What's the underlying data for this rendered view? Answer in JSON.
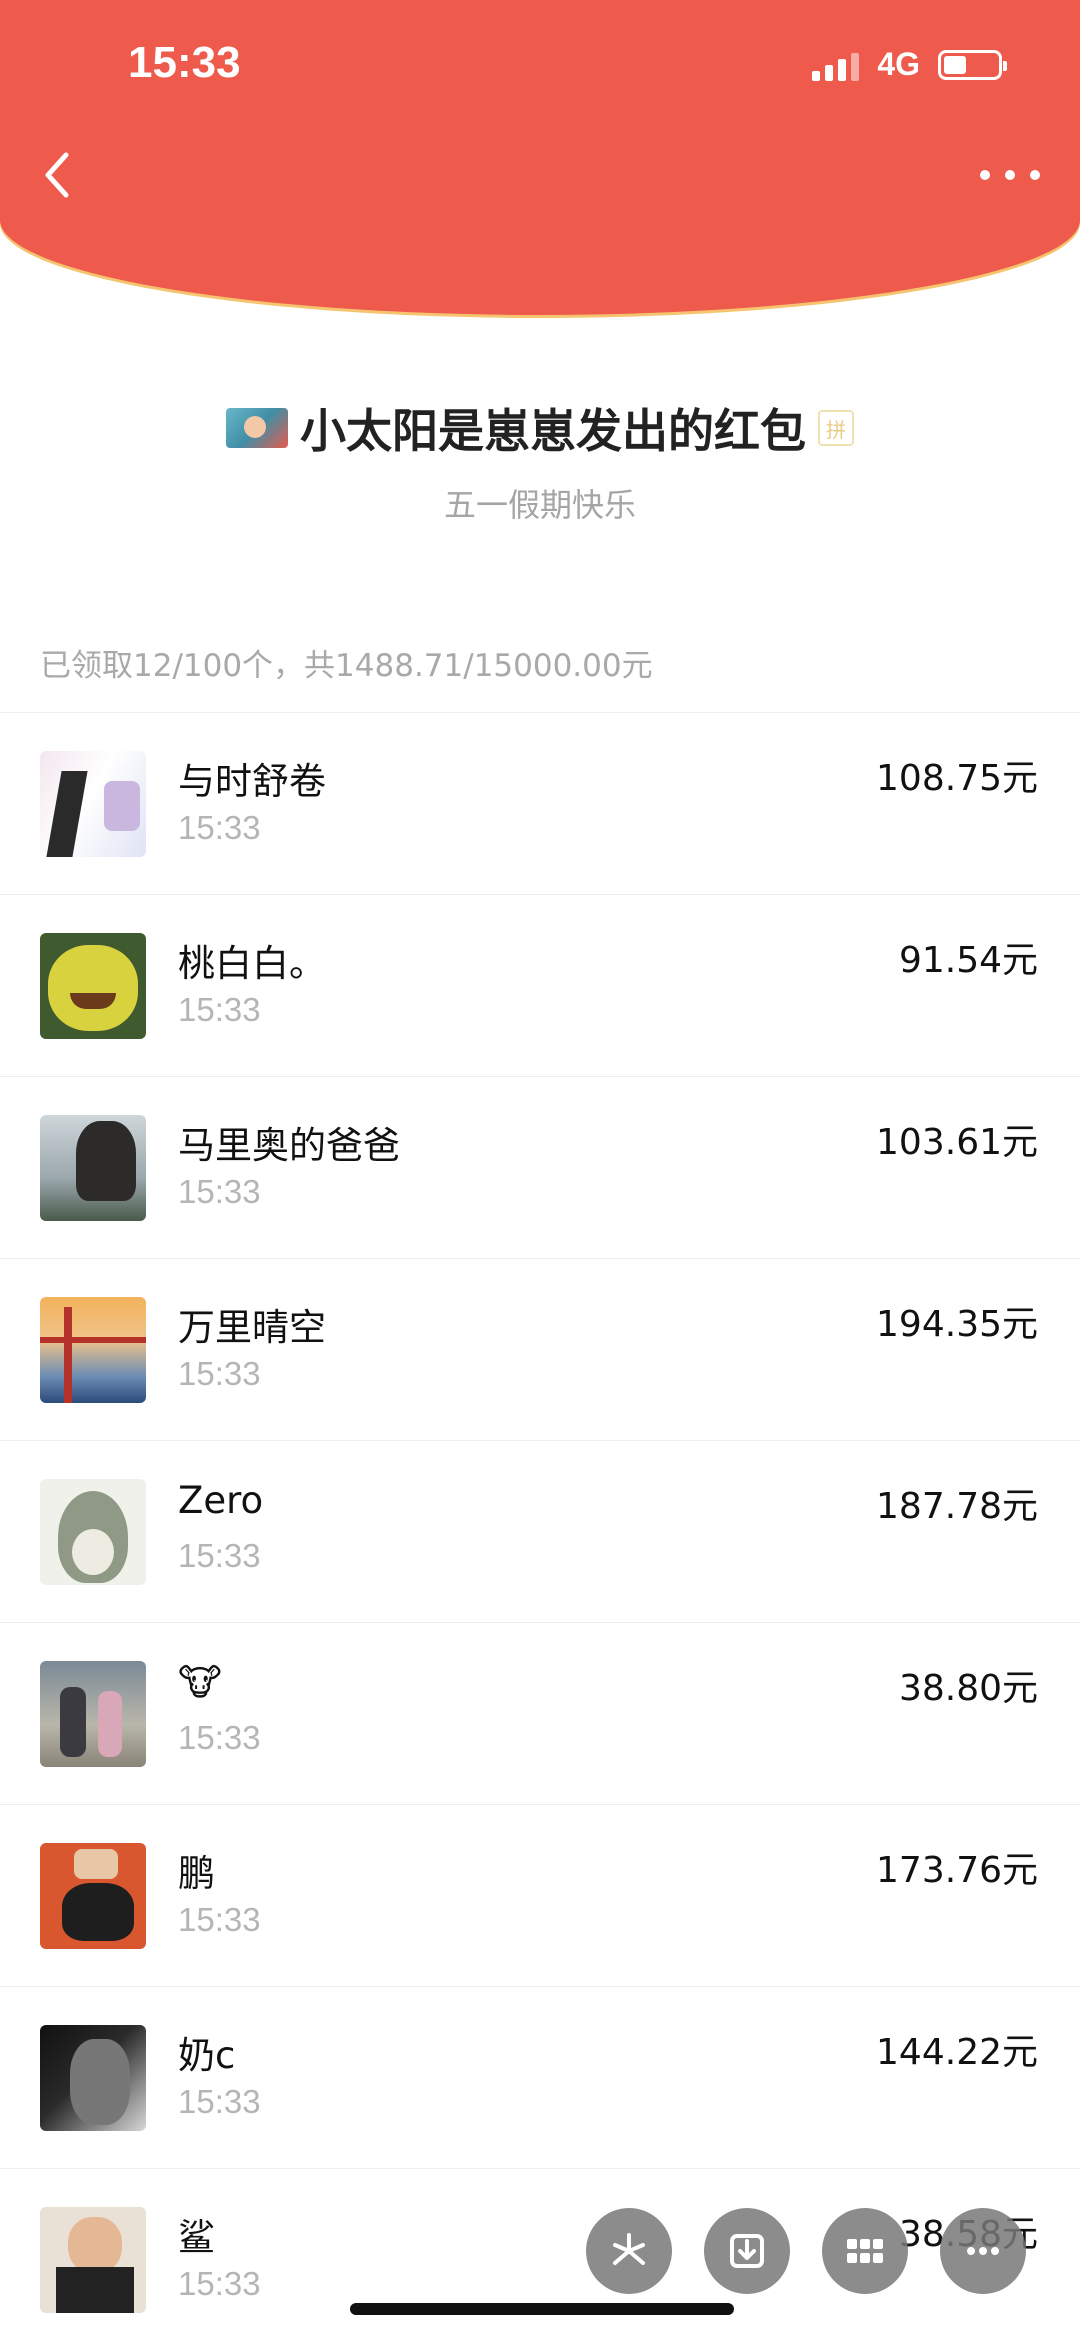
{
  "status_bar": {
    "time": "15:33",
    "network": "4G"
  },
  "header": {
    "title": "小太阳是崽崽发出的红包",
    "pin_badge": "拼",
    "subtitle": "五一假期快乐"
  },
  "summary": "已领取12/100个，共1488.71/15000.00元",
  "records": [
    {
      "name": "与时舒卷",
      "time": "15:33",
      "amount": "108.75元"
    },
    {
      "name": "桃白白。",
      "time": "15:33",
      "amount": "91.54元"
    },
    {
      "name": "马里奥的爸爸",
      "time": "15:33",
      "amount": "103.61元"
    },
    {
      "name": "万里晴空",
      "time": "15:33",
      "amount": "194.35元"
    },
    {
      "name": "Zero",
      "time": "15:33",
      "amount": "187.78元"
    },
    {
      "name": "🐮",
      "time": "15:33",
      "amount": "38.80元"
    },
    {
      "name": "鹏",
      "time": "15:33",
      "amount": "173.76元"
    },
    {
      "name": "奶c",
      "time": "15:33",
      "amount": "144.22元"
    },
    {
      "name": "鲨",
      "time": "15:33",
      "amount": "38.58元"
    }
  ],
  "icons": {
    "back": "chevron-left-icon",
    "more": "ellipsis-icon",
    "toolbar": [
      "pinwheel-icon",
      "download-icon",
      "grid-icon",
      "ellipsis-icon"
    ]
  },
  "colors": {
    "header_red": "#ee5a4b",
    "header_gold_edge": "#f6c46e",
    "muted_text": "#a9a9a9"
  }
}
